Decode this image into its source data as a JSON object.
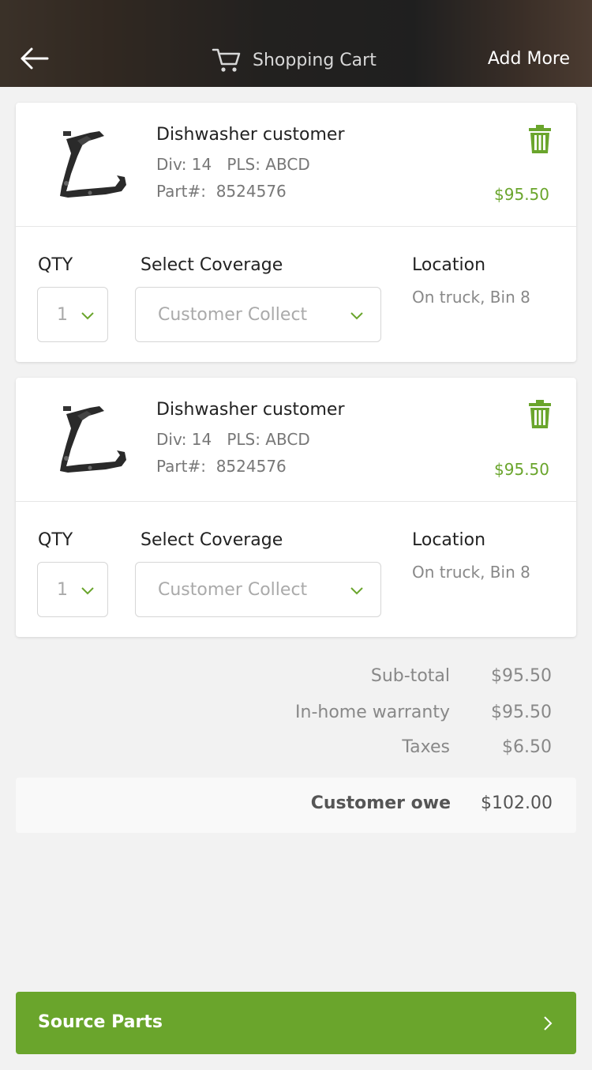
{
  "header": {
    "title": "Shopping Cart",
    "add_more_label": "Add More",
    "icons": {
      "back": "arrow-left-icon",
      "cart": "shopping-cart-icon"
    }
  },
  "items": [
    {
      "name": "Dishwasher customer",
      "div_pls": "Div: 14   PLS: ABCD",
      "part": "Part#:  8524576",
      "price": "$95.50",
      "qty_label": "QTY",
      "qty_value": "1",
      "coverage_label": "Select Coverage",
      "coverage_value": "Customer Collect",
      "location_label": "Location",
      "location_value": "On truck, Bin 8"
    },
    {
      "name": "Dishwasher customer",
      "div_pls": "Div: 14   PLS: ABCD",
      "part": "Part#:  8524576",
      "price": "$95.50",
      "qty_label": "QTY",
      "qty_value": "1",
      "coverage_label": "Select Coverage",
      "coverage_value": "Customer Collect",
      "location_label": "Location",
      "location_value": "On truck, Bin 8"
    }
  ],
  "totals": {
    "subtotal_label": "Sub-total",
    "subtotal_value": "$95.50",
    "warranty_label": "In-home warranty",
    "warranty_value": "$95.50",
    "taxes_label": "Taxes",
    "taxes_value": "$6.50",
    "owe_label": "Customer owe",
    "owe_value": "$102.00"
  },
  "footer": {
    "button_label": "Source Parts"
  },
  "colors": {
    "accent": "#6aa52c",
    "background": "#f2f2f2"
  }
}
